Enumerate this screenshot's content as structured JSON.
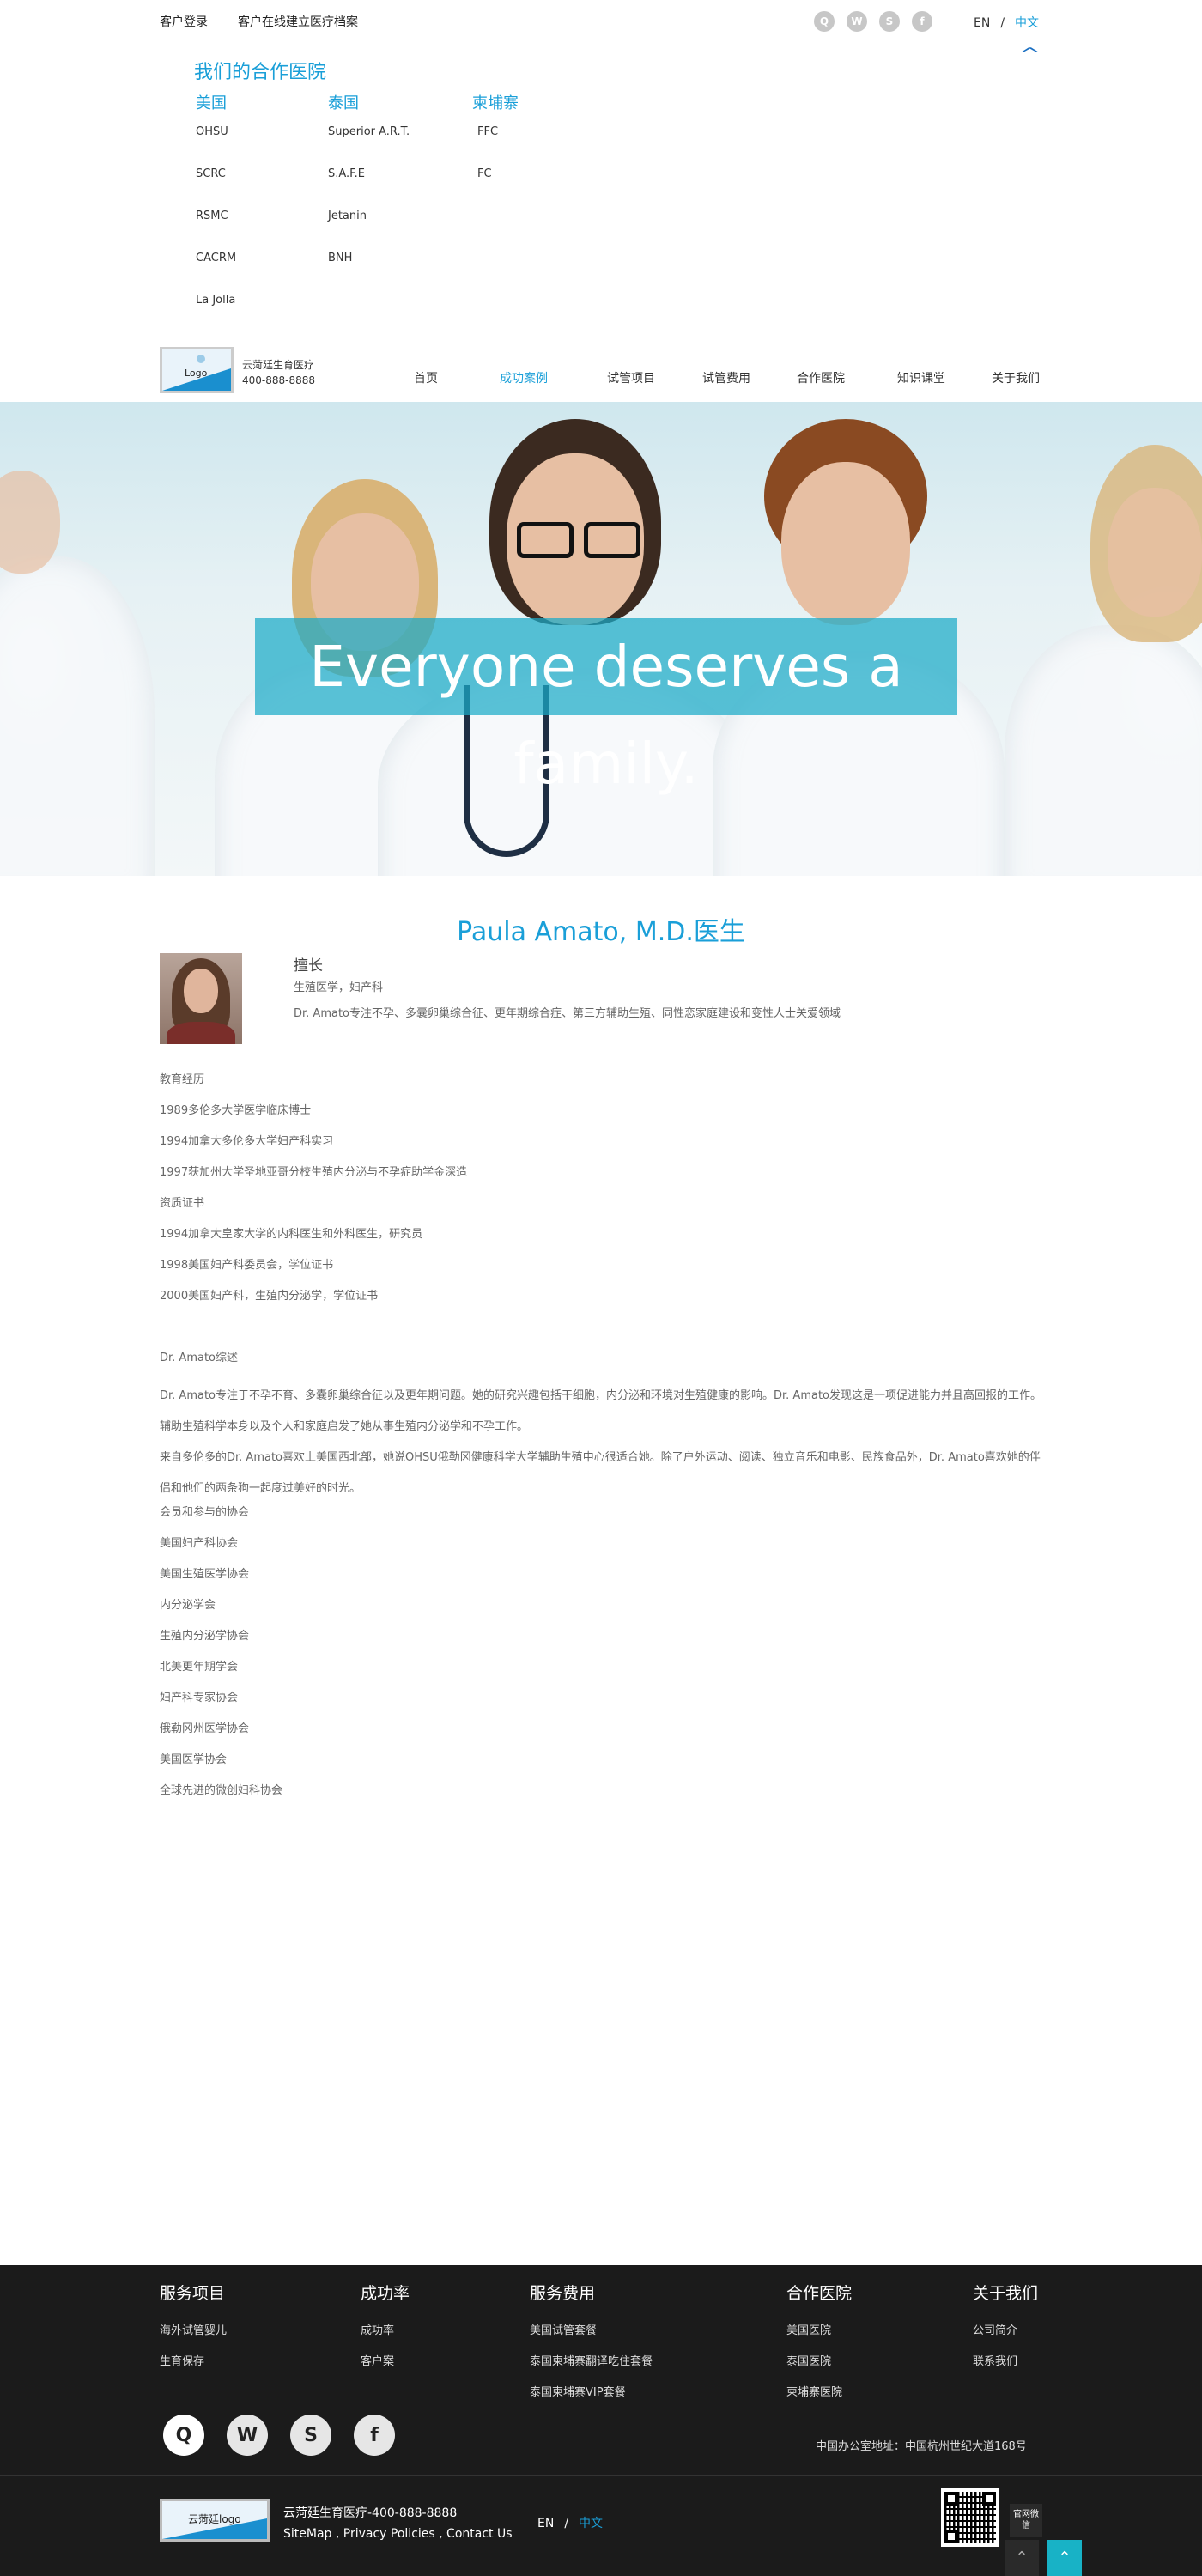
{
  "topbar": {
    "login": "客户登录",
    "record": "客户在线建立医疗档案",
    "social_icons": [
      "qq-icon",
      "wechat-icon",
      "weibo-icon",
      "facebook-icon"
    ],
    "lang_en": "EN",
    "lang_sep": "/",
    "lang_zh": "中文"
  },
  "partners": {
    "title": "我们的合作医院",
    "us": {
      "title": "美国",
      "items": [
        "OHSU",
        "SCRC",
        "RSMC",
        "CACRM",
        "La Jolla"
      ]
    },
    "th": {
      "title": "泰国",
      "items": [
        "Superior A.R.T.",
        "S.A.F.E",
        "Jetanin",
        "BNH"
      ]
    },
    "kh": {
      "title": "柬埔寨",
      "items": [
        "FFC",
        "FC"
      ]
    }
  },
  "header": {
    "logo_text": "Logo",
    "brand_name": "云菏廷生育医疗",
    "phone": "400-888-8888",
    "nav": [
      "首页",
      "成功案例",
      "试管项目",
      "试管费用",
      "合作医院",
      "知识课堂",
      "关于我们"
    ],
    "active_index": 1
  },
  "banner": {
    "slogan": "Everyone deserves a family."
  },
  "doctor": {
    "name": "Paula Amato, M.D.医生",
    "specialty_heading": "擅长",
    "specialty_fields": "生殖医学，妇产科",
    "specialty_desc": "Dr. Amato专注不孕、多囊卵巢综合征、更年期综合症、第三方辅助生殖、同性恋家庭建设和变性人士关爱领域"
  },
  "content": {
    "education_heading": "教育经历",
    "education": [
      "1989多伦多大学医学临床博士",
      "1994加拿大多伦多大学妇产科实习",
      "1997获加州大学圣地亚哥分校生殖内分泌与不孕症助学金深造"
    ],
    "cert_heading": "资质证书",
    "certs": [
      "1994加拿大皇家大学的内科医生和外科医生，研究员",
      "1998美国妇产科委员会，学位证书",
      "2000美国妇产科，生殖内分泌学，学位证书"
    ],
    "summary_heading": "Dr. Amato综述",
    "summary_p1": "Dr. Amato专注于不孕不育、多囊卵巢综合征以及更年期问题。她的研究兴趣包括干细胞，内分泌和环境对生殖健康的影响。Dr. Amato发现这是一项促进能力并且高回报的工作。辅助生殖科学本身以及个人和家庭启发了她从事生殖内分泌学和不孕工作。",
    "summary_p2": "来自多伦多的Dr. Amato喜欢上美国西北部，她说OHSU俄勒冈健康科学大学辅助生殖中心很适合她。除了户外运动、阅读、独立音乐和电影、民族食品外，Dr. Amato喜欢她的伴侣和他们的两条狗一起度过美好的时光。",
    "members_heading": "会员和参与的协会",
    "members": [
      "美国妇产科协会",
      "美国生殖医学协会",
      "内分泌学会",
      "生殖内分泌学协会",
      "北美更年期学会",
      "妇产科专家协会",
      "俄勒冈州医学协会",
      "美国医学协会",
      "全球先进的微创妇科协会"
    ]
  },
  "footer": {
    "services": {
      "title": "服务项目",
      "items": [
        "海外试管婴儿",
        "生育保存"
      ]
    },
    "success": {
      "title": "成功率",
      "items": [
        "成功率",
        "客户案"
      ]
    },
    "fees": {
      "title": "服务费用",
      "items": [
        "美国试管套餐",
        "泰国柬埔寨翻译吃住套餐",
        "泰国柬埔寨VIP套餐"
      ]
    },
    "hospitals": {
      "title": "合作医院",
      "items": [
        "美国医院",
        "泰国医院",
        "柬埔寨医院"
      ]
    },
    "about": {
      "title": "关于我们",
      "items": [
        "公司简介",
        "联系我们"
      ]
    },
    "address": "中国办公室地址：中国杭州世纪大道168号",
    "logo_text": "云菏廷logo",
    "brand_line": "云菏廷生育医疗-400-888-8888",
    "links": "SiteMap , Privacy Policies , Contact Us",
    "lang_en": "EN",
    "lang_sep": "/",
    "lang_zh": "中文",
    "side_tag": "官网微信"
  },
  "colors": {
    "accent": "#1a9fd8",
    "footer_bg": "#1b1b1b",
    "slogan_bg": "#1aaac8"
  }
}
